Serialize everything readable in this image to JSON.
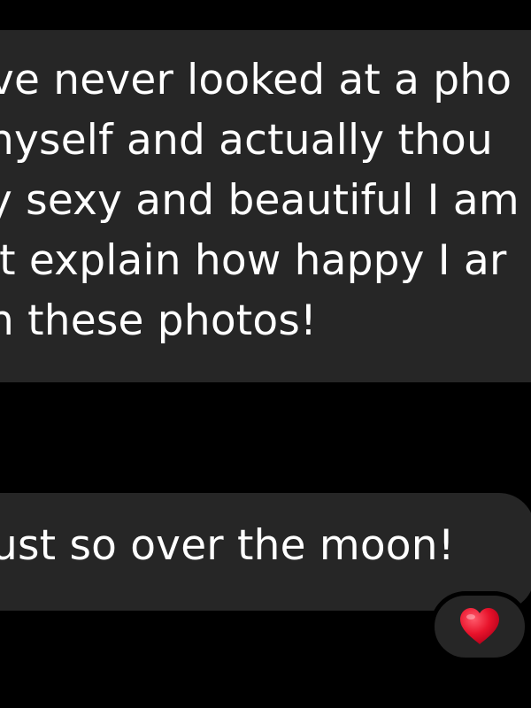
{
  "messages": [
    {
      "lines": [
        "ve never looked at a pho",
        "nyself and actually thou",
        "y sexy and beautiful I am",
        "'t explain how happy I ar",
        "n these photos!"
      ]
    },
    {
      "lines": [
        "ust so over the moon!"
      ]
    }
  ],
  "reaction": {
    "icon": "red-heart-icon",
    "color": "#e8132b"
  },
  "colors": {
    "background": "#000000",
    "bubble": "#262626",
    "text": "#ffffff"
  }
}
